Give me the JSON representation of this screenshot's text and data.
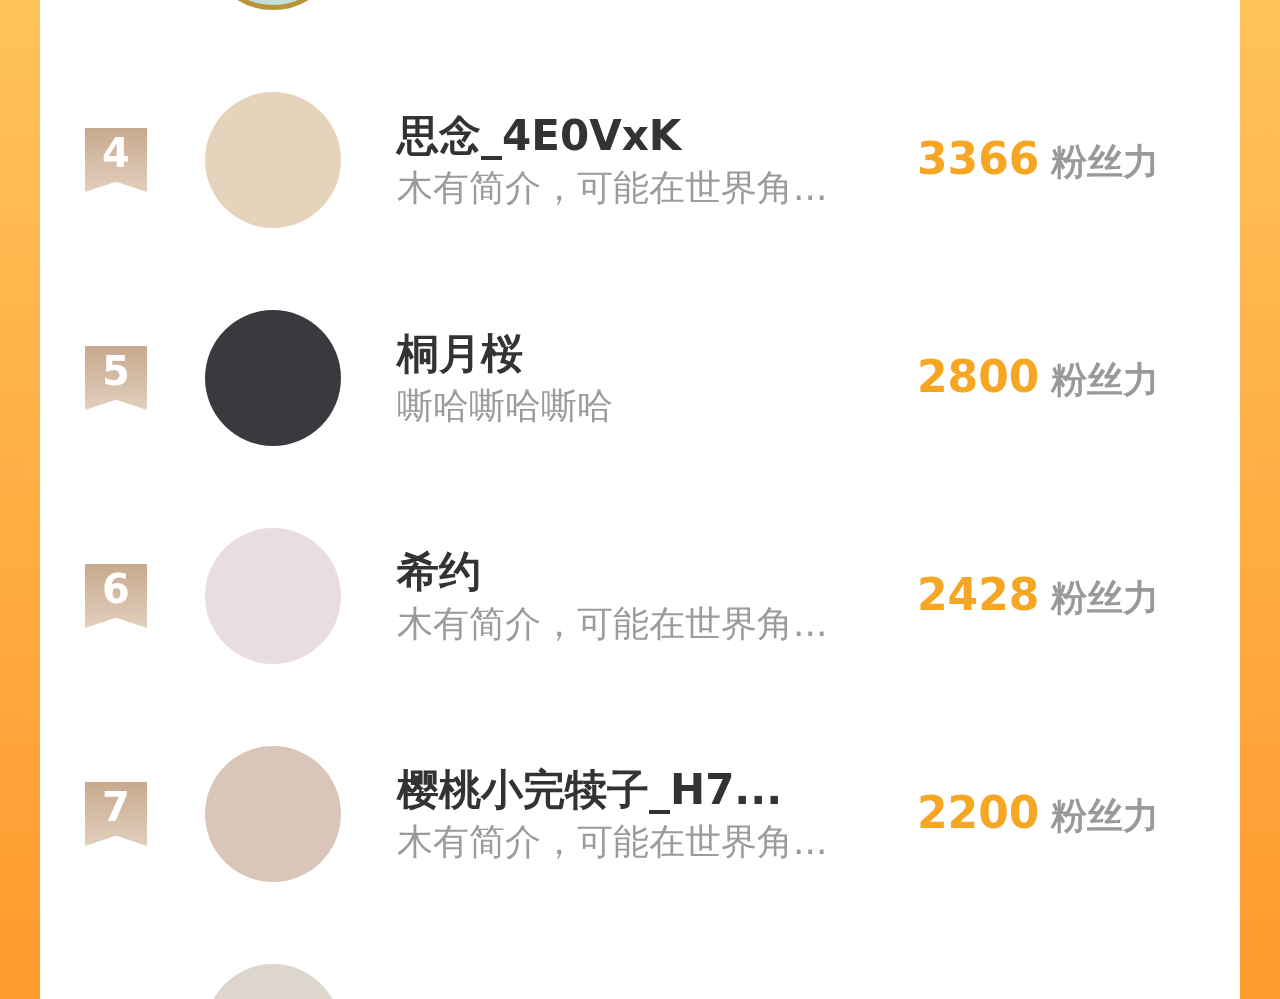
{
  "fans": [
    {
      "rank": "4",
      "name": "思念_4E0VxK",
      "bio": "木有简介，可能在世界角...",
      "score": "3366",
      "score_unit": "粉丝力"
    },
    {
      "rank": "5",
      "name": "桐月桜",
      "bio": "嘶哈嘶哈嘶哈",
      "score": "2800",
      "score_unit": "粉丝力"
    },
    {
      "rank": "6",
      "name": "希约",
      "bio": "木有简介，可能在世界角...",
      "score": "2428",
      "score_unit": "粉丝力"
    },
    {
      "rank": "7",
      "name": "樱桃小完犊子_H7...",
      "bio": "木有简介，可能在世界角...",
      "score": "2200",
      "score_unit": "粉丝力"
    }
  ]
}
